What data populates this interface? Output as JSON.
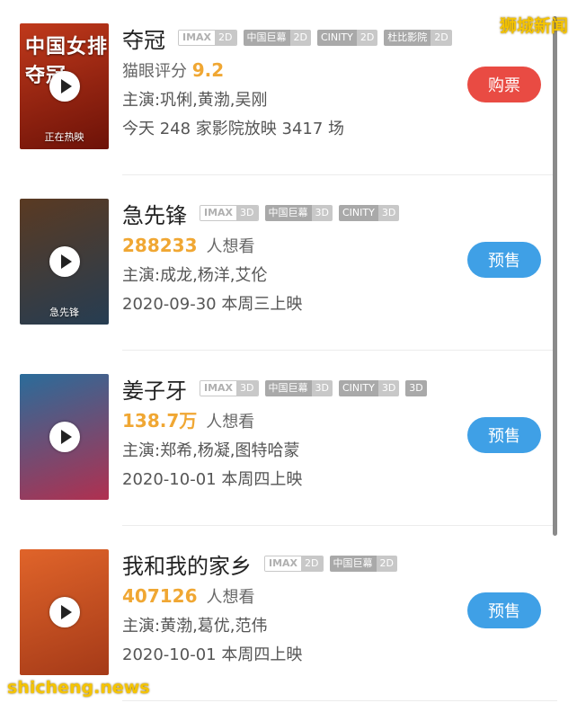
{
  "watermark_top": "狮城新闻",
  "watermark_bottom": "shicheng.news",
  "movies": [
    {
      "title": "夺冠",
      "tags": [
        {
          "left": "IMAX",
          "right": "2D",
          "imax": true
        },
        {
          "left": "中国巨幕",
          "right": "2D"
        },
        {
          "left": "CINITY",
          "right": "2D"
        },
        {
          "left": "杜比影院",
          "right": "2D"
        }
      ],
      "score_label": "猫眼评分",
      "score_value": "9.2",
      "cast": "主演:巩俐,黄渤,吴刚",
      "line3": "今天 248 家影院放映 3417 场",
      "button": "购票",
      "button_type": "buy",
      "poster_title": "中国女排 夺冠",
      "poster_bottom": "正在热映",
      "poster_colors": [
        "#c0391b",
        "#6d1208"
      ]
    },
    {
      "title": "急先锋",
      "tags": [
        {
          "left": "IMAX",
          "right": "3D",
          "imax": true
        },
        {
          "left": "中国巨幕",
          "right": "3D"
        },
        {
          "left": "CINITY",
          "right": "3D"
        }
      ],
      "want_value": "288233",
      "want_label": "人想看",
      "cast": "主演:成龙,杨洋,艾伦",
      "line3": "2020-09-30 本周三上映",
      "button": "预售",
      "button_type": "pre",
      "poster_title": "",
      "poster_bottom": "急先锋",
      "poster_colors": [
        "#5a3a22",
        "#263d52"
      ]
    },
    {
      "title": "姜子牙",
      "tags": [
        {
          "left": "IMAX",
          "right": "3D",
          "imax": true
        },
        {
          "left": "中国巨幕",
          "right": "3D"
        },
        {
          "left": "CINITY",
          "right": "3D"
        },
        {
          "left": "3D",
          "right": ""
        }
      ],
      "want_value": "138.7万",
      "want_label": "人想看",
      "cast": "主演:郑希,杨凝,图特哈蒙",
      "line3": "2020-10-01 本周四上映",
      "button": "预售",
      "button_type": "pre",
      "poster_title": "",
      "poster_bottom": "",
      "poster_colors": [
        "#2a6c9a",
        "#b03050"
      ]
    },
    {
      "title": "我和我的家乡",
      "tags": [
        {
          "left": "IMAX",
          "right": "2D",
          "imax": true
        },
        {
          "left": "中国巨幕",
          "right": "2D"
        }
      ],
      "want_value": "407126",
      "want_label": "人想看",
      "cast": "主演:黄渤,葛优,范伟",
      "line3": "2020-10-01 本周四上映",
      "button": "预售",
      "button_type": "pre",
      "poster_title": "",
      "poster_bottom": "",
      "poster_colors": [
        "#e0642a",
        "#a53a18"
      ]
    }
  ]
}
